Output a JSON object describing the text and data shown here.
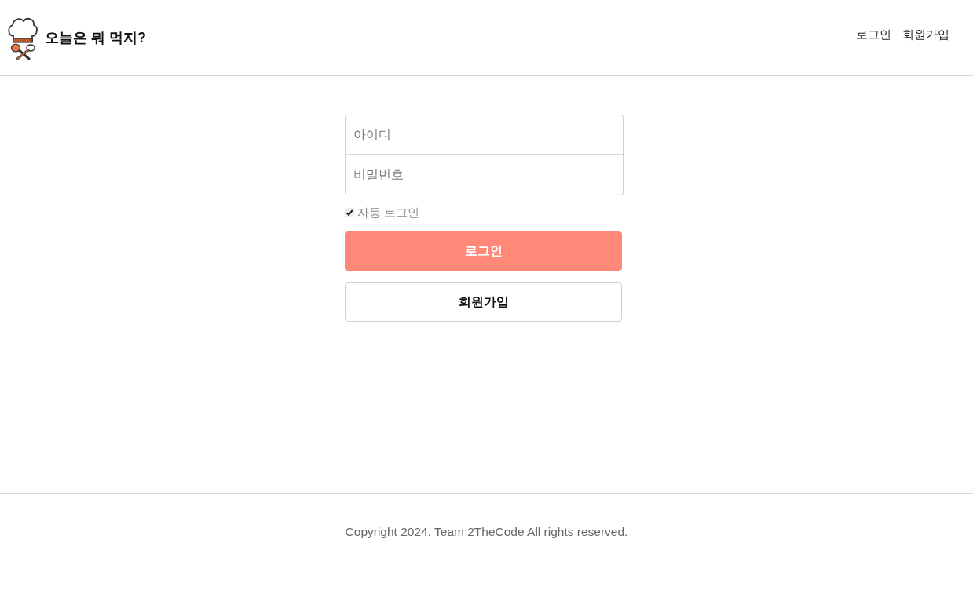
{
  "header": {
    "title": "오늘은 뭐 먹지?",
    "nav": [
      "로그인",
      "회원가입"
    ]
  },
  "login_form": {
    "id_field": {
      "placeholder": "아이디"
    },
    "password_field": {
      "placeholder": "비밀번호"
    },
    "auto_login": {
      "label": "자동 로그인",
      "checked": true
    },
    "buttons": [
      {
        "label": "로그인",
        "kind": "primary"
      },
      {
        "label": "회원가입",
        "kind": "secondary"
      }
    ]
  },
  "footer": {
    "text": "Copyright 2024. Team 2TheCode All rights reserved."
  }
}
